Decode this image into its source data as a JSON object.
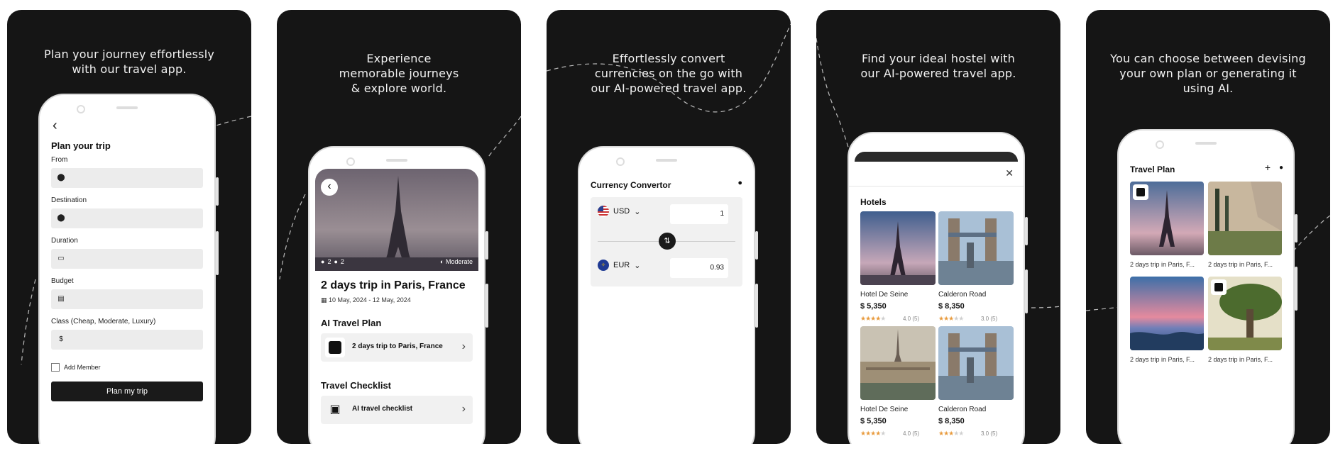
{
  "panels": [
    {
      "caption": "Plan your journey effortlessly with our travel app.",
      "screen": {
        "title": "Plan your trip",
        "fields": [
          {
            "label": "From",
            "icon": "location-pin-icon"
          },
          {
            "label": "Destination",
            "icon": "location-pin-icon"
          },
          {
            "label": "Duration",
            "icon": "calendar-icon"
          },
          {
            "label": "Budget",
            "icon": "receipt-icon"
          },
          {
            "label": "Class (Cheap, Moderate, Luxury)",
            "icon": "dollar-icon"
          }
        ],
        "checkbox_label": "Add Member",
        "button": "Plan my trip"
      }
    },
    {
      "caption": "Experience memorable journeys & explore world.",
      "screen": {
        "adults": "2",
        "children": "2",
        "budget_tag": "Moderate",
        "trip_title": "2 days trip in Paris, France",
        "dates": "10 May, 2024 - 12 May, 2024",
        "ai_section": "AI Travel Plan",
        "ai_item": "2 days trip to Paris, France",
        "checklist_section": "Travel Checklist",
        "checklist_item": "AI travel checklist"
      }
    },
    {
      "caption": "Effortlessly convert currencies on the go with our AI-powered travel app.",
      "screen": {
        "title": "Currency Convertor",
        "from_currency": "USD",
        "from_value": "1",
        "to_currency": "EUR",
        "to_value": "0.93"
      }
    },
    {
      "caption": "Find your ideal hostel with our AI-powered travel app.",
      "screen": {
        "title": "Hotels",
        "hotels": [
          {
            "name": "Hotel De Seine",
            "price": "$ 5,350",
            "stars": 4,
            "rating": "4.0 (5)"
          },
          {
            "name": "Calderon Road",
            "price": "$ 8,350",
            "stars": 3,
            "rating": "3.0 (5)"
          },
          {
            "name": "Hotel De Seine",
            "price": "$ 5,350",
            "stars": 4,
            "rating": "4.0 (5)"
          },
          {
            "name": "Calderon Road",
            "price": "$ 8,350",
            "stars": 3,
            "rating": "3.0 (5)"
          }
        ]
      }
    },
    {
      "caption": "You can choose between devising your own plan or generating it using AI.",
      "screen": {
        "title": "Travel Plan",
        "plans": [
          {
            "caption": "2 days trip in Paris, F..."
          },
          {
            "caption": "2 days trip in Paris, F..."
          },
          {
            "caption": "2 days trip in Paris, F..."
          },
          {
            "caption": "2 days trip in Paris, F..."
          }
        ]
      }
    }
  ],
  "colors": {
    "panel_bg": "#151515",
    "star": "#e89a3c",
    "button_dark": "#1a1a1a"
  }
}
